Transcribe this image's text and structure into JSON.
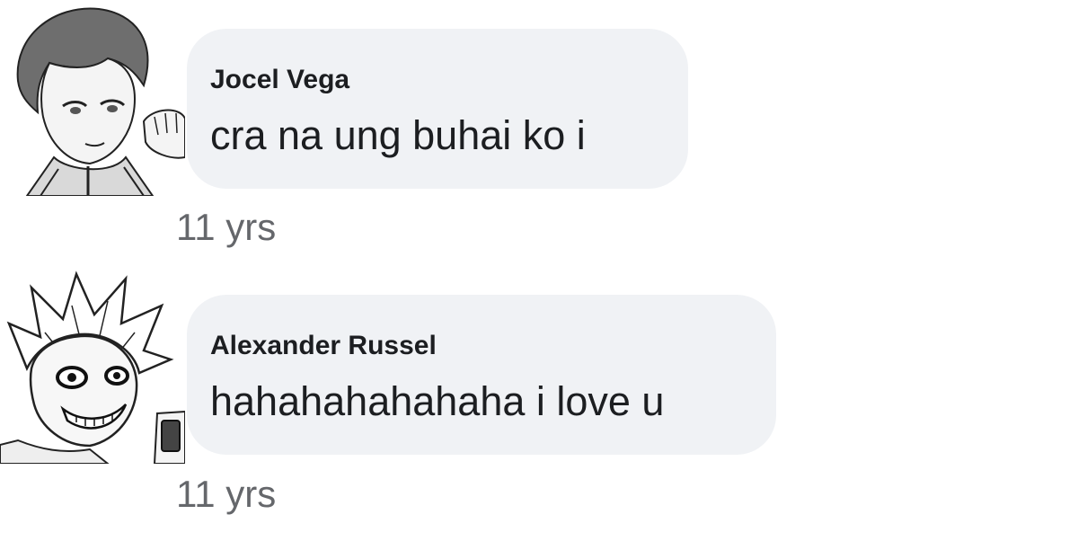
{
  "comments": [
    {
      "author": "Jocel Vega",
      "text": "cra na ung buhai ko i",
      "time": "11 yrs",
      "avatar_icon": "manga-character-avatar"
    },
    {
      "author": "Alexander Russel",
      "text": "hahahahahahaha i love u",
      "time": "11 yrs",
      "avatar_icon": "manga-character-avatar"
    }
  ],
  "colors": {
    "bubble_bg": "#f0f2f5",
    "text": "#1c1e21",
    "meta": "#65676b"
  }
}
